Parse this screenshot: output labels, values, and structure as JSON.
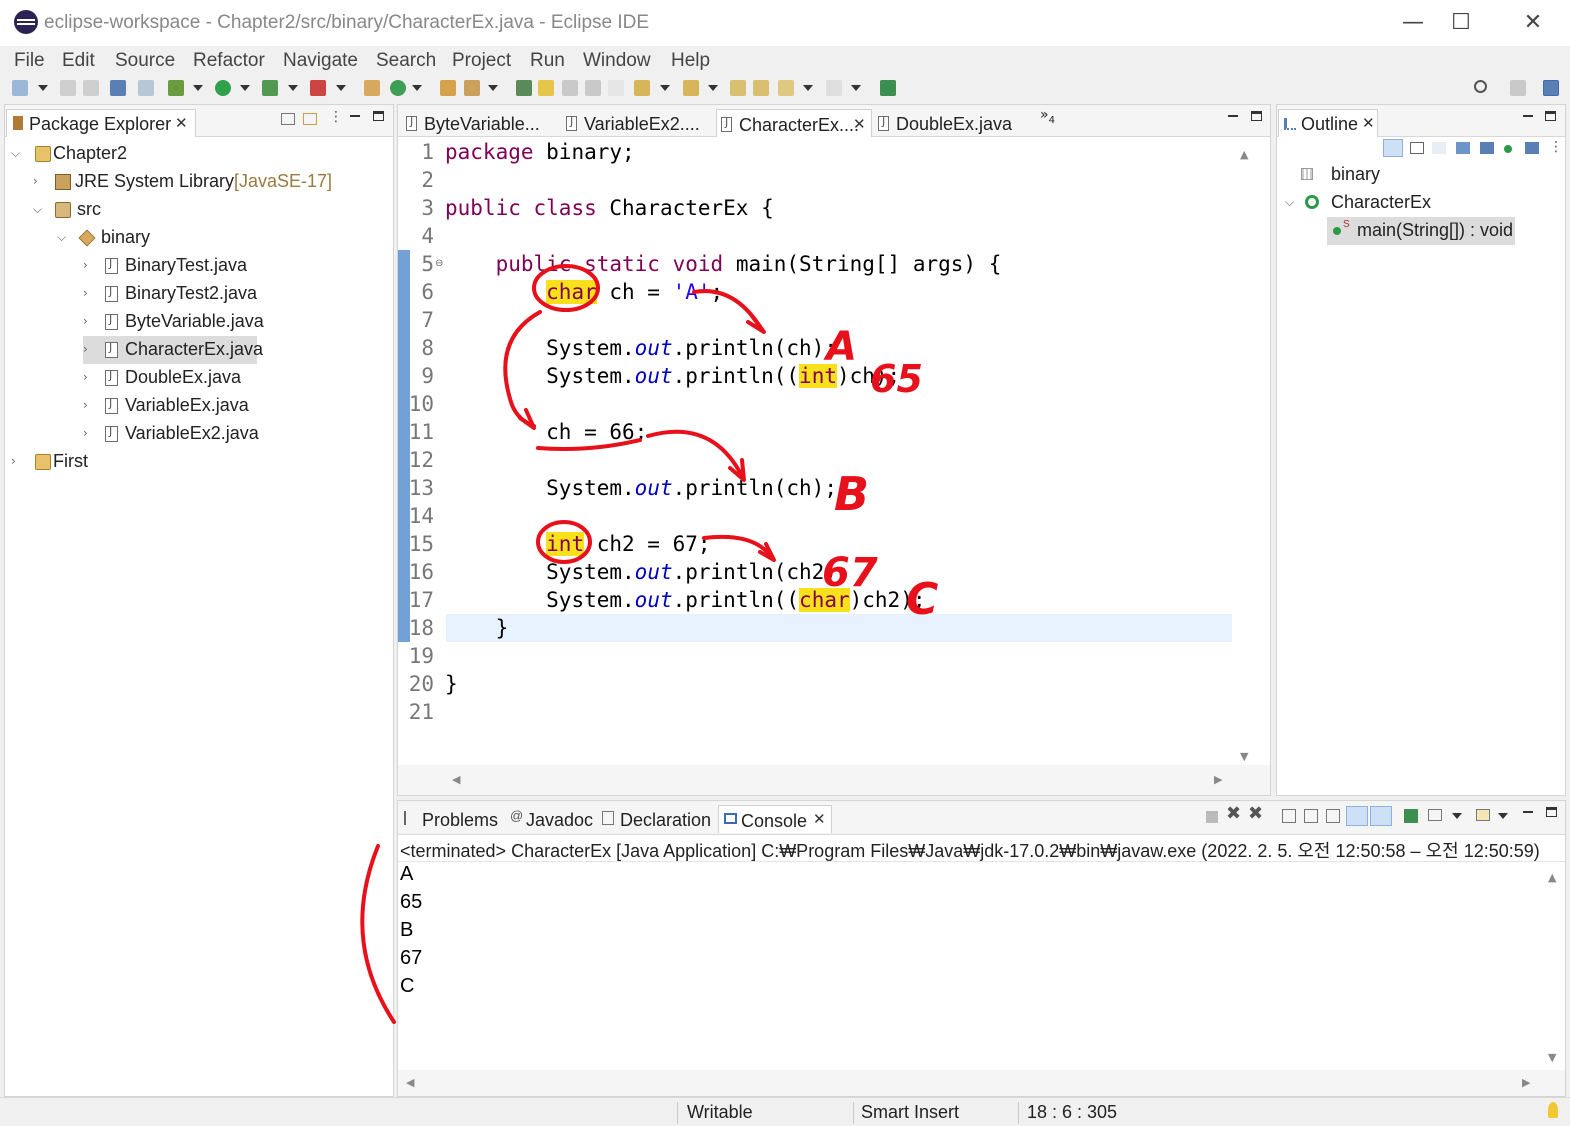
{
  "window": {
    "title": "eclipse-workspace - Chapter2/src/binary/CharacterEx.java - Eclipse IDE",
    "minimize": "—",
    "maximize": "☐",
    "close": "✕"
  },
  "menu": [
    "File",
    "Edit",
    "Source",
    "Refactor",
    "Navigate",
    "Search",
    "Project",
    "Run",
    "Window",
    "Help"
  ],
  "package_explorer": {
    "tab_label": "Package Explorer",
    "tree": [
      {
        "label": "Chapter2"
      },
      {
        "label": "JRE System Library",
        "suffix": "[JavaSE-17]"
      },
      {
        "label": "src"
      },
      {
        "label": "binary"
      },
      {
        "label": "BinaryTest.java"
      },
      {
        "label": "BinaryTest2.java"
      },
      {
        "label": "ByteVariable.java"
      },
      {
        "label": "CharacterEx.java"
      },
      {
        "label": "DoubleEx.java"
      },
      {
        "label": "VariableEx.java"
      },
      {
        "label": "VariableEx2.java"
      },
      {
        "label": "First"
      }
    ]
  },
  "editor": {
    "tabs": [
      "ByteVariable...",
      "VariableEx2....",
      "CharacterEx....",
      "DoubleEx.java"
    ],
    "overflow_count": "4",
    "line_numbers": [
      "1",
      "2",
      "3",
      "4",
      "5",
      "6",
      "7",
      "8",
      "9",
      "10",
      "11",
      "12",
      "13",
      "14",
      "15",
      "16",
      "17",
      "18",
      "19",
      "20",
      "21"
    ],
    "code": {
      "l1_kw": "package",
      "l1_rest": " binary;",
      "l3_kw1": "public",
      "l3_kw2": "class",
      "l3_rest": " CharacterEx {",
      "l5_kw1": "public",
      "l5_kw2": "static",
      "l5_kw3": "void",
      "l5_rest": " main(String[] args) {",
      "l6_kw": "char",
      "l6_mid": " ch = ",
      "l6_str": "'A'",
      "l6_end": ";",
      "l8_a": "System.",
      "l8_f": "out",
      "l8_b": ".println(ch);",
      "l9_a": "System.",
      "l9_f": "out",
      "l9_b": ".println((",
      "l9_kw": "int",
      "l9_c": ")ch);",
      "l11": "ch = 66;",
      "l13_a": "System.",
      "l13_f": "out",
      "l13_b": ".println(ch);",
      "l15_kw": "int",
      "l15_rest": " ch2 = 67;",
      "l16_a": "System.",
      "l16_f": "out",
      "l16_b": ".println(ch2);",
      "l17_a": "System.",
      "l17_f": "out",
      "l17_b": ".println((",
      "l17_kw": "char",
      "l17_c": ")ch2);",
      "l18": "}",
      "l20": "}"
    }
  },
  "outline": {
    "tab_label": "Outline",
    "items": [
      "binary",
      "CharacterEx",
      "main(String[]) : void"
    ]
  },
  "bottom": {
    "tabs": [
      "Problems",
      "Javadoc",
      "Declaration",
      "Console"
    ],
    "console_header": "<terminated> CharacterEx [Java Application] C:₩Program Files₩Java₩jdk-17.0.2₩bin₩javaw.exe  (2022. 2. 5. 오전 12:50:58 – 오전 12:50:59)",
    "output": [
      "A",
      "65",
      "B",
      "67",
      "C"
    ]
  },
  "status": {
    "writable": "Writable",
    "insert_mode": "Smart Insert",
    "position": "18 : 6 : 305"
  },
  "annotations": [
    "A",
    "65",
    "B",
    "67",
    "C"
  ],
  "colors": {
    "keyword": "#7f0055",
    "highlight": "#f8e11a",
    "string": "#2a00ff",
    "field": "#0000c0",
    "pen": "#e8101a",
    "current_line": "#e8f2fe"
  }
}
